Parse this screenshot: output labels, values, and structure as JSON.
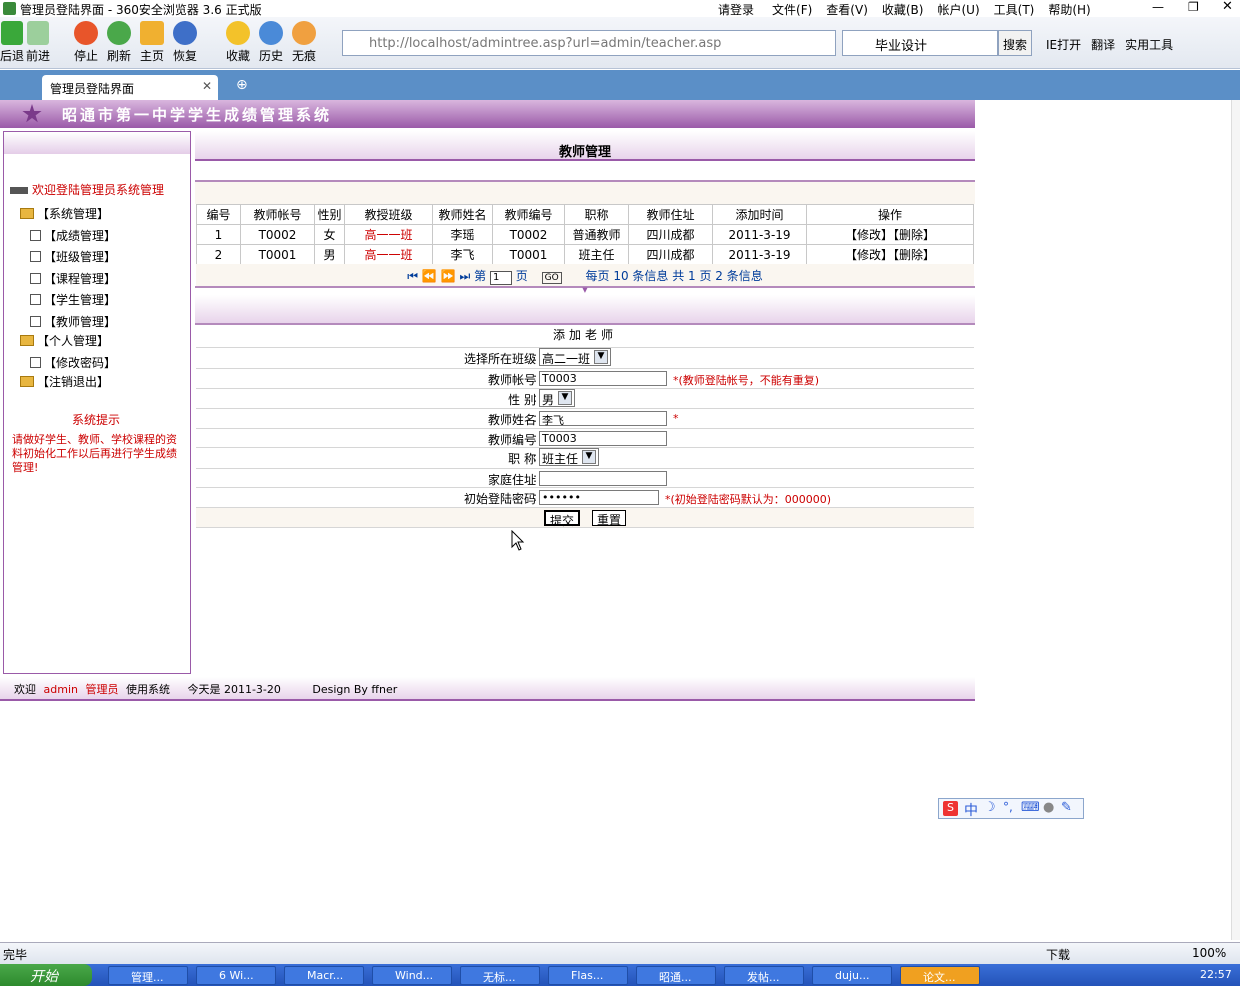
{
  "window": {
    "title": "管理员登陆界面 - 360安全浏览器 3.6 正式版"
  },
  "menu": {
    "items": [
      "请登录",
      "文件(F)",
      "查看(V)",
      "收藏(B)",
      "帐户(U)",
      "工具(T)",
      "帮助(H)"
    ]
  },
  "toolbar": {
    "back": "后退",
    "forward": "前进",
    "stop": "停止",
    "refresh": "刷新",
    "home": "主页",
    "restore": "恢复",
    "favorites": "收藏",
    "history": "历史",
    "private": "无痕"
  },
  "address": {
    "url": "http://localhost/admintree.asp?url=admin/teacher.asp"
  },
  "search": {
    "value": "毕业设计",
    "button": "搜索"
  },
  "tools": {
    "ie": "IE打开",
    "translate": "翻译",
    "utilities": "实用工具"
  },
  "tab": {
    "label": "管理员登陆界面"
  },
  "banner": {
    "title": "昭通市第一中学学生成绩管理系统"
  },
  "sidebar": {
    "welcome": "欢迎登陆管理员系统管理",
    "groups": [
      {
        "label": "【系统管理】",
        "items": [
          "【成绩管理】",
          "【班级管理】",
          "【课程管理】",
          "【学生管理】",
          "【教师管理】"
        ]
      },
      {
        "label": "【个人管理】",
        "items": [
          "【修改密码】"
        ]
      },
      {
        "label": "【注销退出】",
        "items": []
      }
    ],
    "tip_title": "系统提示",
    "tip_text": "请做好学生、教师、学校课程的资料初始化工作以后再进行学生成绩管理!"
  },
  "main": {
    "title": "教师管理",
    "table": {
      "headers": [
        "编号",
        "教师帐号",
        "性别",
        "教授班级",
        "教师姓名",
        "教师编号",
        "职称",
        "教师住址",
        "添加时间",
        "操作"
      ],
      "rows": [
        [
          "1",
          "T0002",
          "女",
          "高一一班",
          "李瑶",
          "T0002",
          "普通教师",
          "四川成都",
          "2011-3-19"
        ],
        [
          "2",
          "T0001",
          "男",
          "高一一班",
          "李飞",
          "T0001",
          "班主任",
          "四川成都",
          "2011-3-19"
        ]
      ],
      "edit_label": "【修改】",
      "delete_label": "【删除】"
    },
    "pager": {
      "page_prefix": "第",
      "page_value": "1",
      "page_suffix": "页",
      "go": "GO",
      "summary": "每页 10 条信息 共 1 页 2 条信息"
    },
    "form": {
      "title": "添加老师",
      "class_label": "选择所在班级",
      "class_value": "高二一班",
      "account_label": "教师帐号",
      "account_value": "T0003",
      "account_hint": "*(教师登陆帐号，不能有重复)",
      "gender_label": "性 别",
      "gender_value": "男",
      "name_label": "教师姓名",
      "name_value": "李飞",
      "name_hint": "*",
      "number_label": "教师编号",
      "number_value": "T0003",
      "title_label": "职 称",
      "title_value": "班主任",
      "address_label": "家庭住址",
      "address_value": "",
      "password_label": "初始登陆密码",
      "password_value": "••••••",
      "password_hint": "*(初始登陆密码默认为：000000)",
      "submit": "提交",
      "reset": "重置"
    }
  },
  "footer": {
    "welcome": "欢迎",
    "user": "admin",
    "role": "管理员",
    "use": "使用系统",
    "date": "今天是 2011-3-20",
    "design": "Design By ffner"
  },
  "status": {
    "text": "完毕",
    "download": "下载",
    "zoom": "100%"
  },
  "taskbar": {
    "start": "开始",
    "tasks": [
      "管理...",
      "6 Wi...",
      "Macr...",
      "Wind...",
      "无标...",
      "Flas...",
      "昭通...",
      "发帖...",
      "duju...",
      "论文..."
    ],
    "clock": "22:57"
  },
  "colors": {
    "accent": "#9a5aa8",
    "link_red": "#cc0000",
    "tab_blue": "#5b8fc7"
  }
}
